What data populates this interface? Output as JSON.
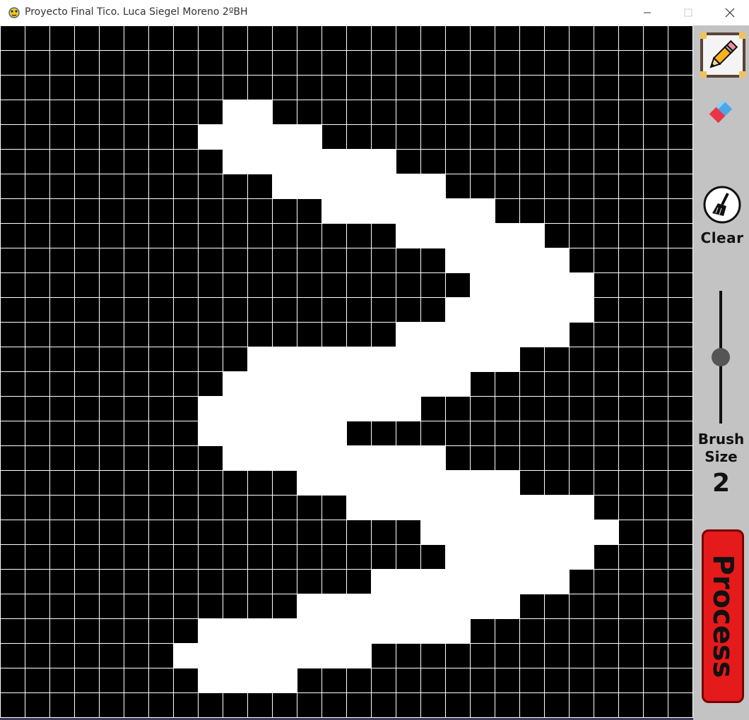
{
  "window": {
    "title": "Proyecto Final Tico. Luca Siegel Moreno 2ºBH",
    "app_icon": "pygame-snake-icon",
    "controls": [
      "minimize-icon",
      "maximize-icon",
      "close-icon"
    ]
  },
  "canvas": {
    "columns": 28,
    "rows": 28,
    "cell_colors": {
      "on": "#ffffff",
      "off": "#000000",
      "grid_line": "#ffffff"
    },
    "white_runs_by_row": [
      [],
      [],
      [],
      [
        [
          9,
          10
        ]
      ],
      [
        [
          8,
          12
        ]
      ],
      [
        [
          9,
          15
        ]
      ],
      [
        [
          11,
          17
        ]
      ],
      [
        [
          13,
          19
        ]
      ],
      [
        [
          16,
          21
        ]
      ],
      [
        [
          18,
          22
        ]
      ],
      [
        [
          19,
          23
        ]
      ],
      [
        [
          18,
          23
        ]
      ],
      [
        [
          16,
          22
        ]
      ],
      [
        [
          10,
          20
        ]
      ],
      [
        [
          9,
          18
        ]
      ],
      [
        [
          8,
          16
        ]
      ],
      [
        [
          8,
          13
        ]
      ],
      [
        [
          9,
          17
        ]
      ],
      [
        [
          12,
          20
        ]
      ],
      [
        [
          14,
          23
        ]
      ],
      [
        [
          17,
          24
        ]
      ],
      [
        [
          18,
          23
        ]
      ],
      [
        [
          15,
          22
        ]
      ],
      [
        [
          12,
          20
        ]
      ],
      [
        [
          8,
          18
        ]
      ],
      [
        [
          7,
          14
        ]
      ],
      [
        [
          8,
          11
        ]
      ],
      []
    ]
  },
  "sidebar": {
    "background": "#c3c3c3",
    "pencil": {
      "icon": "pencil-icon",
      "selected": true
    },
    "eraser": {
      "icon": "eraser-icon"
    },
    "clear": {
      "icon": "broom-icon",
      "label": "Clear"
    },
    "brush": {
      "label_line1": "Brush",
      "label_line2": "Size",
      "value": "2",
      "slider_level": 0.5
    },
    "process": {
      "label": "Process",
      "color": "#e51a1a"
    }
  }
}
